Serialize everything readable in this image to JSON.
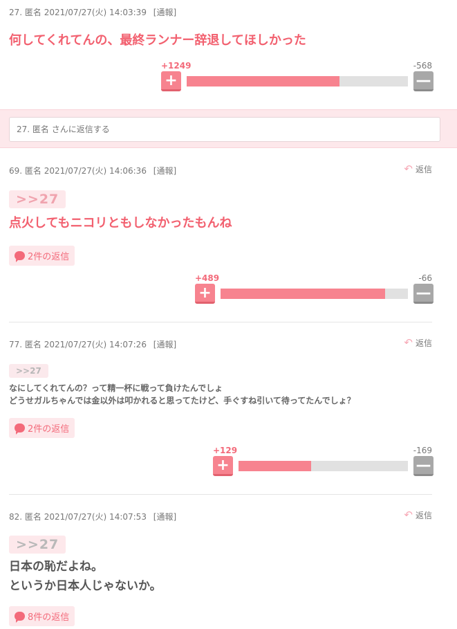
{
  "labels": {
    "report": "[通報]",
    "reply": "返信",
    "reply_arrow": "↶",
    "plus_sign": "+",
    "minus_sign": "—"
  },
  "comments": [
    {
      "meta": "27. 匿名 2021/07/27(火) 14:03:39",
      "body": "何してくれてんの、最終ランナー辞退してほしかった",
      "plus": "+1249",
      "minus": "-568",
      "plus_ratio": 0.69
    },
    {
      "meta": "69. 匿名 2021/07/27(火) 14:06:36",
      "anchor": ">>27",
      "body": "点火してもニコリともしなかったもんね",
      "replies": "2件の返信",
      "plus": "+489",
      "minus": "-66",
      "plus_ratio": 0.88
    },
    {
      "meta": "77. 匿名 2021/07/27(火) 14:07:26",
      "anchor": ">>27",
      "body_line1": "なにしてくれてんの？って精一杯に戦って負けたんでしょ",
      "body_line2": "どうせガルちゃんでは金以外は叩かれると思ってたけど、手ぐすね引いて待ってたんでしょ？",
      "replies": "2件の返信",
      "plus": "+129",
      "minus": "-169",
      "plus_ratio": 0.43
    },
    {
      "meta": "82. 匿名 2021/07/27(火) 14:07:53",
      "anchor": ">>27",
      "body_line1": "日本の恥だよね。",
      "body_line2": "というか日本人じゃないか。",
      "replies": "8件の返信"
    }
  ],
  "reply_box": {
    "placeholder": "27. 匿名 さんに返信する"
  },
  "colors": {
    "accent_pink": "#f2606f",
    "vote_plus": "#f7838f",
    "vote_minus": "#a8a8a8",
    "reply_bg": "#fde8eb"
  }
}
